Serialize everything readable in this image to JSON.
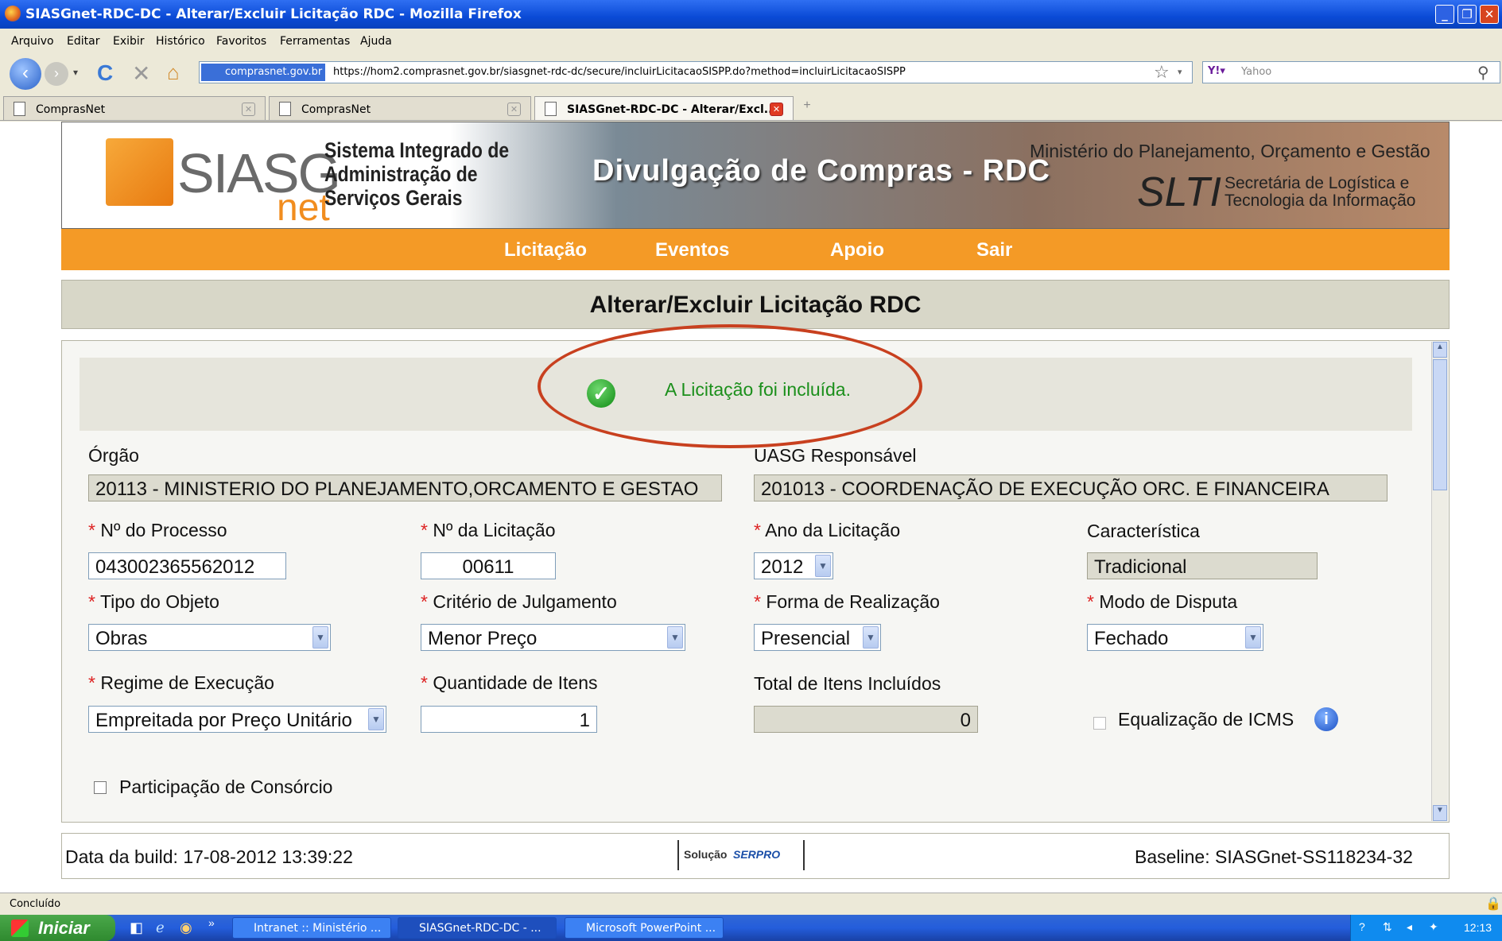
{
  "window": {
    "title": "SIASGnet-RDC-DC - Alterar/Excluir Licitação RDC - Mozilla Firefox"
  },
  "menu": [
    "Arquivo",
    "Editar",
    "Exibir",
    "Histórico",
    "Favoritos",
    "Ferramentas",
    "Ajuda"
  ],
  "nav": {
    "domain": "comprasnet.gov.br",
    "url": "https://hom2.comprasnet.gov.br/siasgnet-rdc-dc/secure/incluirLicitacaoSISPP.do?method=incluirLicitacaoSISPP",
    "search_placeholder": "Yahoo"
  },
  "tabs": [
    {
      "label": "ComprasNet"
    },
    {
      "label": "ComprasNet"
    },
    {
      "label": "SIASGnet-RDC-DC - Alterar/Excl..."
    }
  ],
  "banner": {
    "logo": "SIASG",
    "logo_sub": "net",
    "system_line1": "Sistema Integrado de",
    "system_line2": "Administração de",
    "system_line3": "Serviços Gerais",
    "headline": "Divulgação de Compras - RDC",
    "ministry": "Ministério do Planejamento, Orçamento e Gestão",
    "slti": "SLTI",
    "secretariat_line1": "Secretária de Logística e",
    "secretariat_line2": "Tecnologia da Informação"
  },
  "main_nav": [
    "Licitação",
    "Eventos",
    "Apoio",
    "Sair"
  ],
  "page_title": "Alterar/Excluir Licitação RDC",
  "message": "A Licitação foi incluída.",
  "form": {
    "orgao_label": "Órgão",
    "orgao_value": "20113 - MINISTERIO DO PLANEJAMENTO,ORCAMENTO E GESTAO",
    "uasg_label": "UASG Responsável",
    "uasg_value": "201013 - COORDENAÇÃO DE EXECUÇÃO ORC. E FINANCEIRA",
    "processo_label": "Nº do Processo",
    "processo_value": "043002365562012",
    "licitacao_label": "Nº da Licitação",
    "licitacao_value": "00611",
    "ano_label": "Ano da Licitação",
    "ano_value": "2012",
    "caracteristica_label": "Característica",
    "caracteristica_value": "Tradicional",
    "tipo_label": "Tipo do Objeto",
    "tipo_value": "Obras",
    "criterio_label": "Critério de Julgamento",
    "criterio_value": "Menor Preço",
    "forma_label": "Forma de Realização",
    "forma_value": "Presencial",
    "modo_label": "Modo de Disputa",
    "modo_value": "Fechado",
    "regime_label": "Regime de Execução",
    "regime_value": "Empreitada por Preço Unitário",
    "quantidade_label": "Quantidade de Itens",
    "quantidade_value": "1",
    "total_label": "Total de Itens Incluídos",
    "total_value": "0",
    "icms_label": "Equalização de ICMS",
    "consorcio_label": "Participação de Consórcio",
    "required_mark": "*"
  },
  "footer": {
    "build": "Data da build: 17-08-2012 13:39:22",
    "solucao": "Solução",
    "serpro": "SERPRO",
    "baseline": "Baseline: SIASGnet-SS118234-32"
  },
  "status": "Concluído",
  "taskbar": {
    "start": "Iniciar",
    "items": [
      "Intranet :: Ministério ...",
      "SIASGnet-RDC-DC - ...",
      "Microsoft PowerPoint ..."
    ],
    "clock": "12:13"
  }
}
